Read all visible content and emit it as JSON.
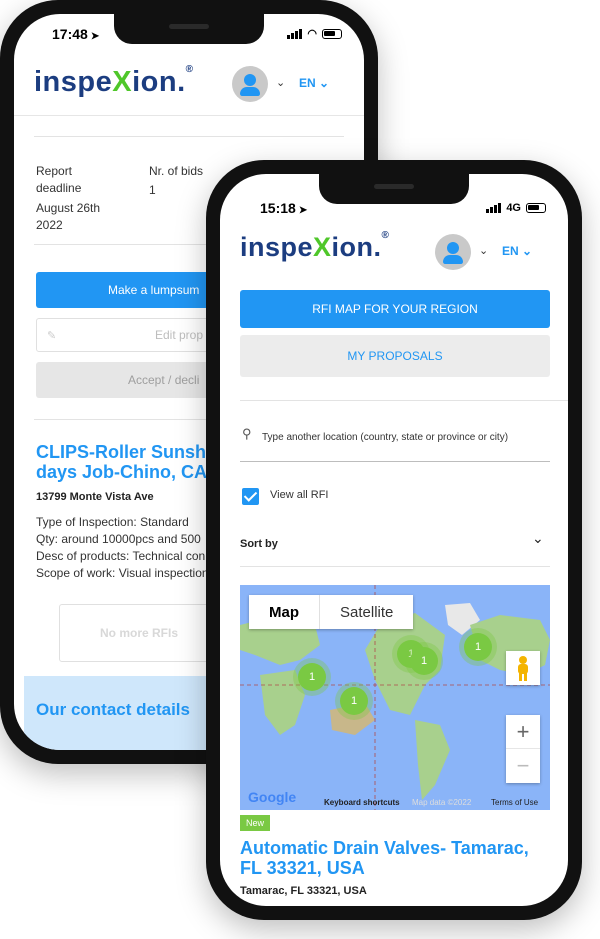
{
  "back_phone": {
    "status": {
      "time": "17:48"
    },
    "header": {
      "logo_main": "inspe",
      "logo_x": "X",
      "logo_end": "ion.",
      "registered": "®",
      "lang": "EN"
    },
    "report_deadline_label": "Report deadline",
    "report_deadline_value": "August 26th 2022",
    "bids_label": "Nr. of bids",
    "bids_value": "1",
    "lumpsum_button": "Make a lumpsum",
    "edit_button": "Edit prop",
    "accept_button": "Accept / decli",
    "rfi_title": "CLIPS-Roller Sunsh days Job-Chino, CA",
    "address": "13799 Monte Vista Ave",
    "details": [
      "Type of Inspection: Standard",
      "Qty: around 10000pcs and 500",
      "Desc of products: Technical con",
      "Scope of work: Visual inspection"
    ],
    "no_more_button": "No more RFIs",
    "contact_heading": "Our contact details"
  },
  "front_phone": {
    "status": {
      "time": "15:18",
      "network": "4G"
    },
    "header": {
      "logo_main": "inspe",
      "logo_x": "X",
      "logo_end": "ion.",
      "registered": "®",
      "lang": "EN"
    },
    "map_button": "RFI MAP FOR YOUR REGION",
    "proposals_button": "MY PROPOSALS",
    "location_placeholder": "Type another location (country, state or province or city)",
    "view_all_label": "View all RFI",
    "sort_label": "Sort by",
    "map": {
      "tab_map": "Map",
      "tab_satellite": "Satellite",
      "clusters": [
        "1",
        "1",
        "1",
        "1",
        "1"
      ],
      "google": "Google",
      "shortcuts": "Keyboard shortcuts",
      "map_data": "Map data ©2022",
      "terms": "Terms of Use",
      "zoom_in": "+",
      "zoom_out": "−"
    },
    "new_badge": "New",
    "rfi_title": "Automatic Drain Valves- Tamarac, FL 33321, USA",
    "rfi_address": "Tamarac, FL 33321, USA"
  }
}
